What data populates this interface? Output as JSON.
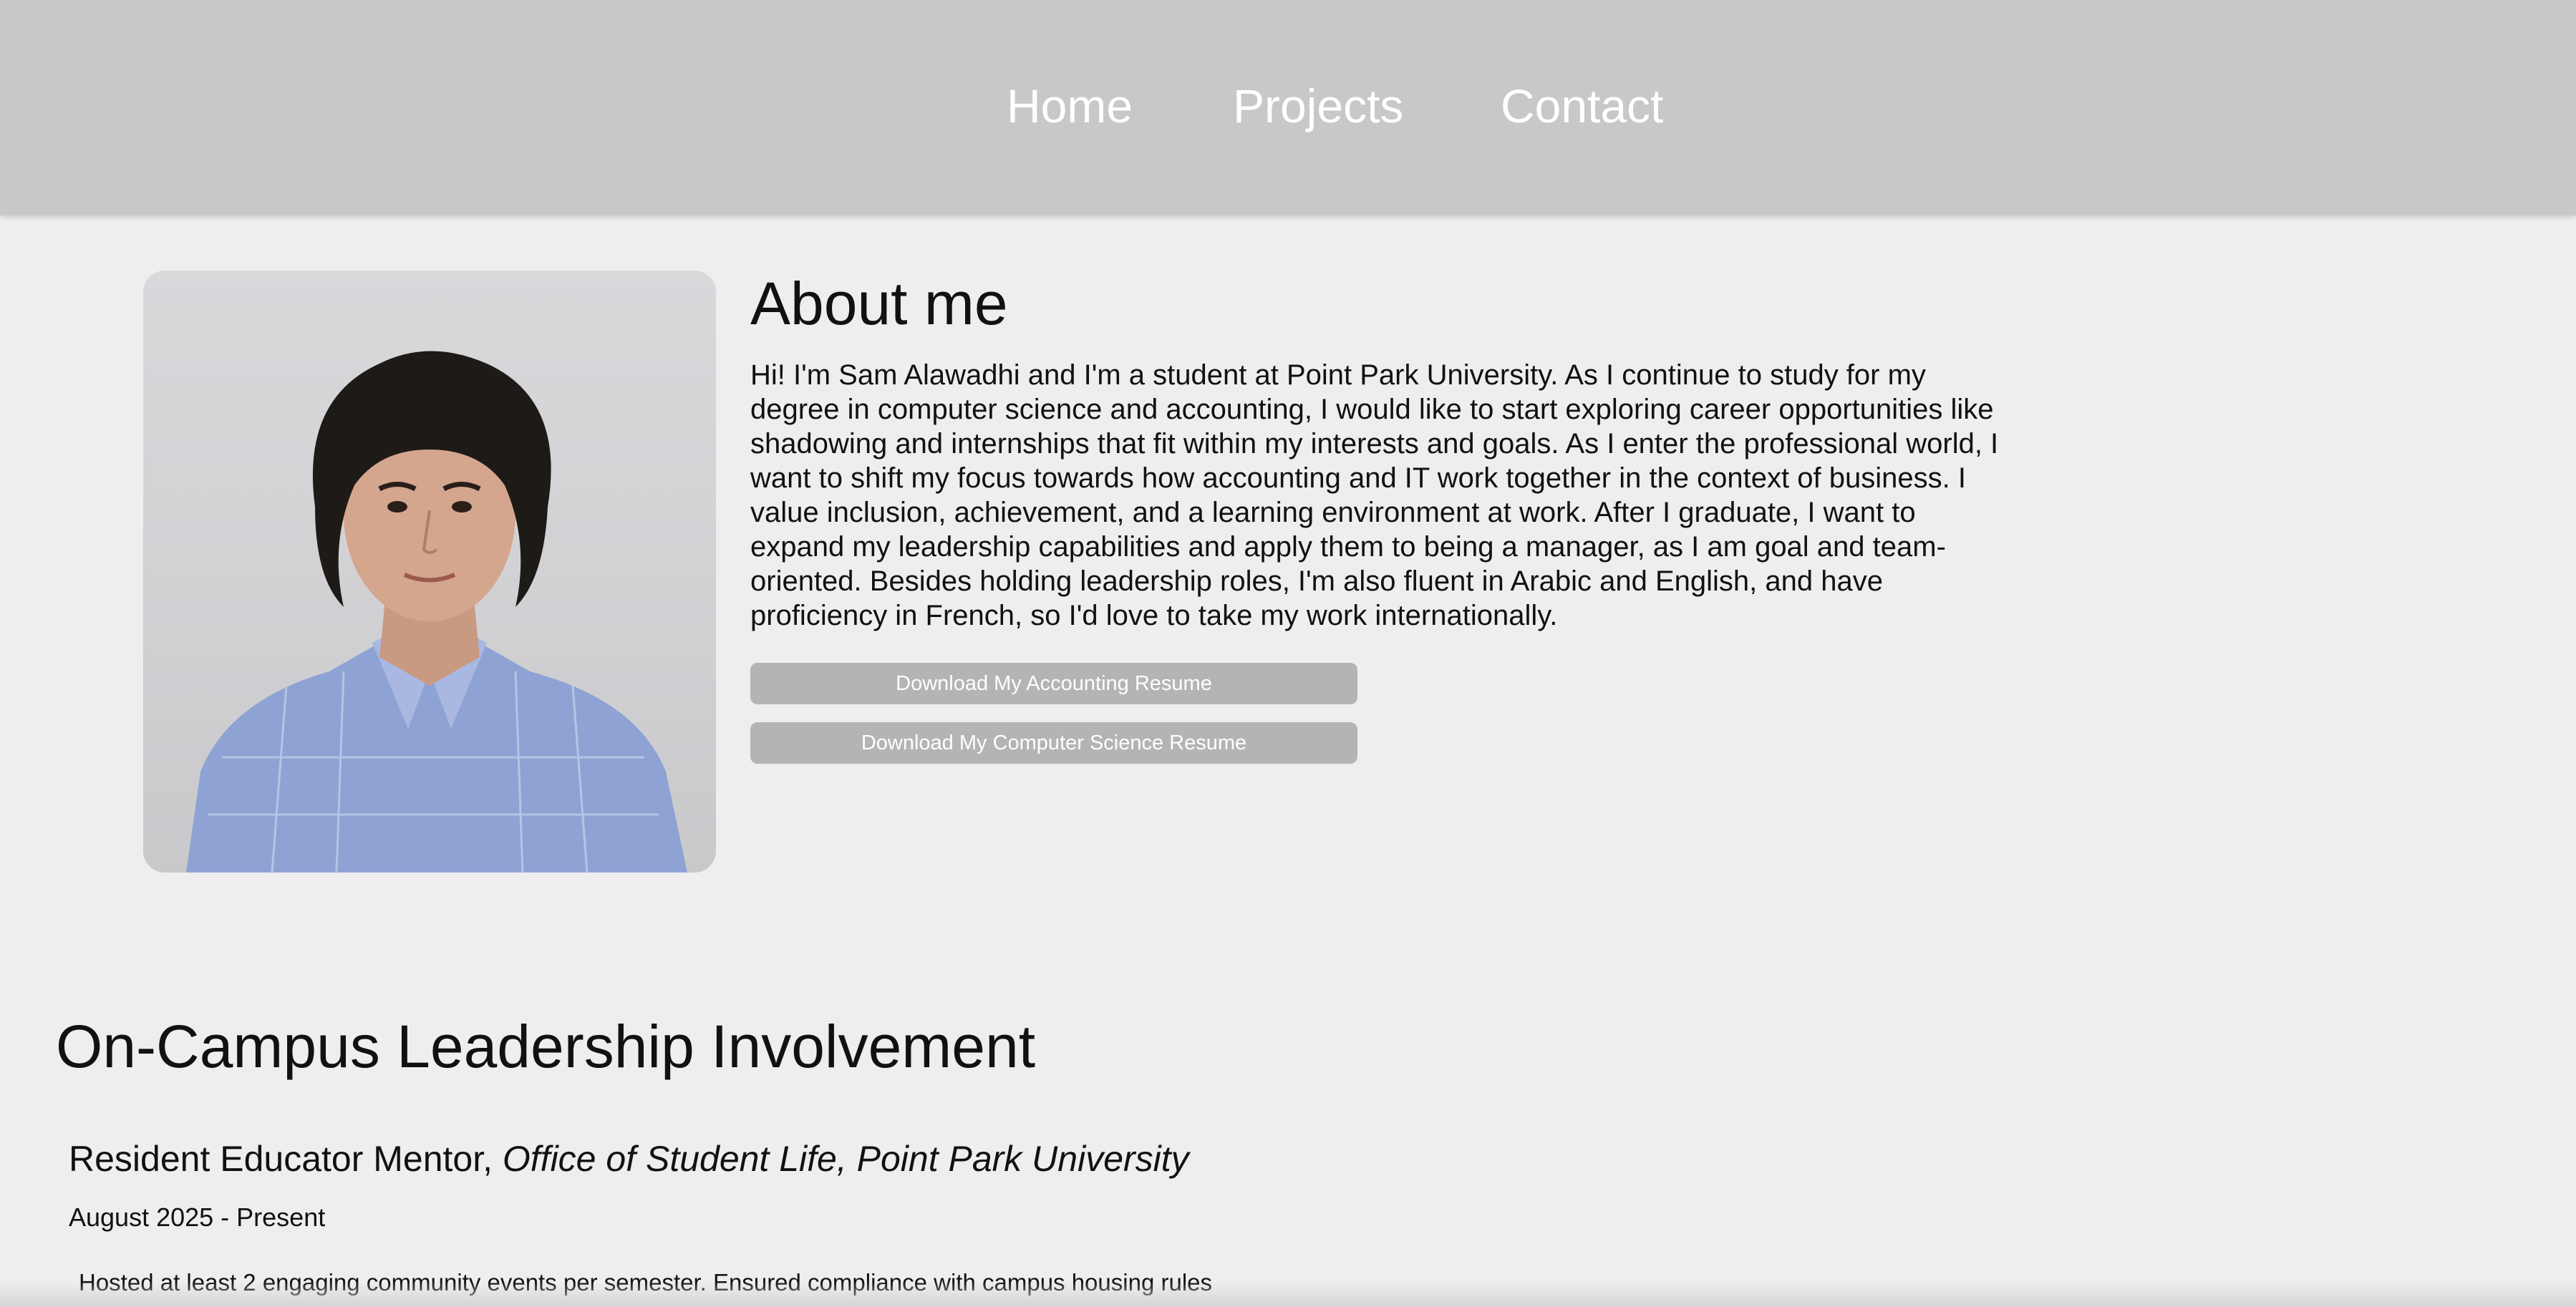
{
  "nav": {
    "items": [
      {
        "label": "Home"
      },
      {
        "label": "Projects"
      },
      {
        "label": "Contact"
      }
    ]
  },
  "about": {
    "title": "About me",
    "body": "Hi! I'm Sam Alawadhi and I'm a student at Point Park University. As I continue to study for my degree in computer science and accounting, I would like to start exploring career opportunities like shadowing and internships that fit within my interests and goals. As I enter the professional world, I want to shift my focus towards how accounting and IT work together in the context of business. I value inclusion, achievement, and a learning environment at work. After I graduate, I want to expand my leadership capabilities and apply them to being a manager, as I am goal and team-oriented. Besides holding leadership roles, I'm also fluent in Arabic and English, and have proficiency in French, so I'd love to take my work internationally.",
    "buttons": {
      "accounting_resume": "Download My Accounting Resume",
      "cs_resume": "Download My Computer Science Resume"
    }
  },
  "leadership": {
    "title": "On-Campus Leadership Involvement",
    "roles": [
      {
        "title": "Resident Educator Mentor, ",
        "org": "Office of Student Life, Point Park University",
        "dates": "August 2025 - Present",
        "description": "Hosted at least 2 engaging community events per semester. Ensured compliance with campus housing rules"
      }
    ]
  },
  "colors": {
    "navbar_bg": "#c8c8c8",
    "page_bg": "#eeeeee",
    "button_bg": "#b4b4b4",
    "nav_text": "#ffffff"
  }
}
